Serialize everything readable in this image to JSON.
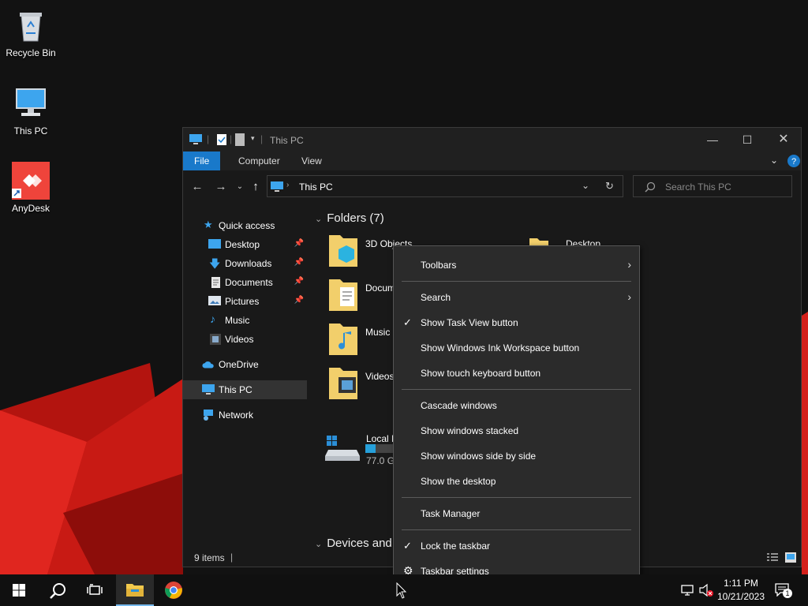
{
  "desktop": {
    "icons": [
      {
        "label": "Recycle Bin"
      },
      {
        "label": "This PC"
      },
      {
        "label": "AnyDesk"
      }
    ]
  },
  "explorer": {
    "title": "This PC",
    "ribbon_tabs": [
      "File",
      "Computer",
      "View"
    ],
    "address": "This PC",
    "search_placeholder": "Search This PC",
    "nav": {
      "quick_access": "Quick access",
      "items": [
        "Desktop",
        "Downloads",
        "Documents",
        "Pictures",
        "Music",
        "Videos"
      ],
      "onedrive": "OneDrive",
      "this_pc": "This PC",
      "network": "Network"
    },
    "folders_header": "Folders (7)",
    "folders": [
      "3D Objects",
      "Docum",
      "Music",
      "Videos",
      "Desktop"
    ],
    "devices_header": "Devices and",
    "drive": {
      "name": "Local D",
      "size": "77.0 GE",
      "usage": 0.35
    },
    "status": "9 items"
  },
  "context_menu": {
    "items": [
      {
        "label": "Toolbars",
        "submenu": true,
        "checked": false
      },
      {
        "label": "Search",
        "submenu": true,
        "checked": false
      },
      {
        "label": "Show Task View button",
        "submenu": false,
        "checked": true
      },
      {
        "label": "Show Windows Ink Workspace button",
        "submenu": false,
        "checked": false
      },
      {
        "label": "Show touch keyboard button",
        "submenu": false,
        "checked": false
      },
      {
        "label": "Cascade windows",
        "submenu": false,
        "checked": false
      },
      {
        "label": "Show windows stacked",
        "submenu": false,
        "checked": false
      },
      {
        "label": "Show windows side by side",
        "submenu": false,
        "checked": false
      },
      {
        "label": "Show the desktop",
        "submenu": false,
        "checked": false
      },
      {
        "label": "Task Manager",
        "submenu": false,
        "checked": false
      },
      {
        "label": "Lock the taskbar",
        "submenu": false,
        "checked": true
      },
      {
        "label": "Taskbar settings",
        "submenu": false,
        "checked": false,
        "icon": "gear-icon"
      }
    ]
  },
  "taskbar": {
    "time": "1:11 PM",
    "date": "10/21/2023",
    "notification_count": "1"
  },
  "colors": {
    "accent": "#1979ca",
    "wallpaper_red": "#d4201b",
    "wallpaper_bg": "#111111"
  }
}
